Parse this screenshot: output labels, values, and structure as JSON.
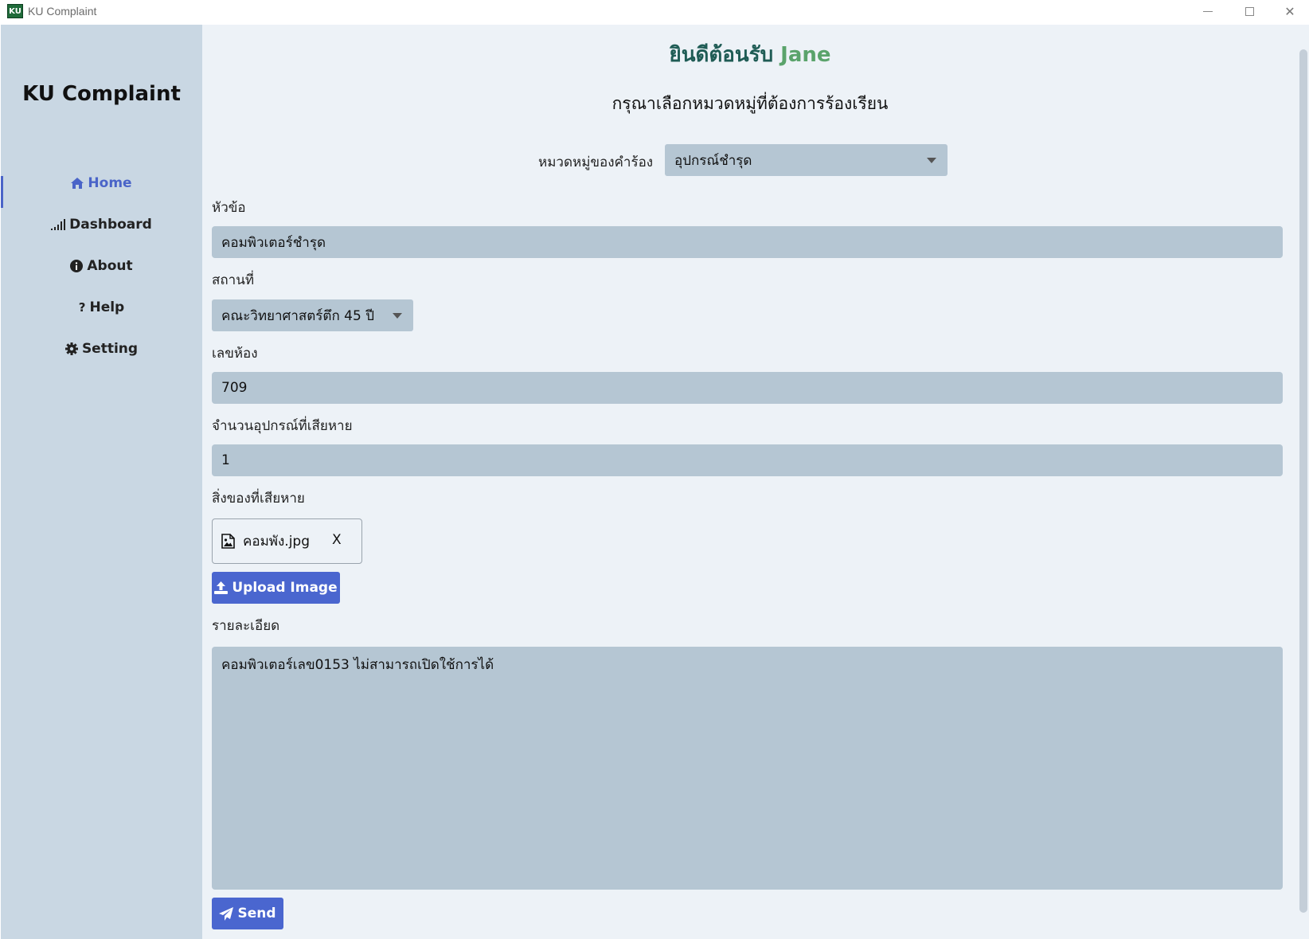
{
  "window": {
    "title": "KU Complaint",
    "icon_text": "KU"
  },
  "sidebar": {
    "brand": "KU Complaint",
    "items": [
      {
        "label": "Home",
        "icon": "home-icon",
        "active": true
      },
      {
        "label": "Dashboard",
        "icon": "signal-bars-icon",
        "active": false
      },
      {
        "label": "About",
        "icon": "info-icon",
        "active": false
      },
      {
        "label": "Help",
        "icon": "question-icon",
        "active": false
      },
      {
        "label": "Setting",
        "icon": "gear-icon",
        "active": false
      }
    ]
  },
  "header": {
    "welcome_prefix": "ยินดีต้อนรับ",
    "welcome_name": "Jane",
    "subtitle": "กรุณาเลือกหมวดหมู่ที่ต้องการร้องเรียน"
  },
  "form": {
    "category": {
      "label": "หมวดหมู่ของคำร้อง",
      "value": "อุปกรณ์ชำรุด"
    },
    "topic": {
      "label": "หัวข้อ",
      "value": "คอมพิวเตอร์ชำรุด"
    },
    "location": {
      "label": "สถานที่",
      "value": "คณะวิทยาศาสตร์ตึก 45 ปี"
    },
    "room": {
      "label": "เลขห้อง",
      "value": "709"
    },
    "quantity": {
      "label": "จำนวนอุปกรณ์ที่เสียหาย",
      "value": "1"
    },
    "items": {
      "label": "สิ่งของที่เสียหาย",
      "file_name": "คอมพัง.jpg",
      "remove_label": "X"
    },
    "upload_label": "Upload Image",
    "details": {
      "label": "รายละเอียด",
      "value": "คอมพิวเตอร์เลข0153 ไม่สามารถเปิดใช้การได้"
    },
    "send_label": "Send"
  },
  "colors": {
    "sidebar_bg": "#c9d7e3",
    "main_bg": "#edf2f7",
    "field_bg": "#b5c6d3",
    "accent": "#4a66cf",
    "welcome_dark": "#1f5c55",
    "welcome_name": "#5aa36b"
  }
}
